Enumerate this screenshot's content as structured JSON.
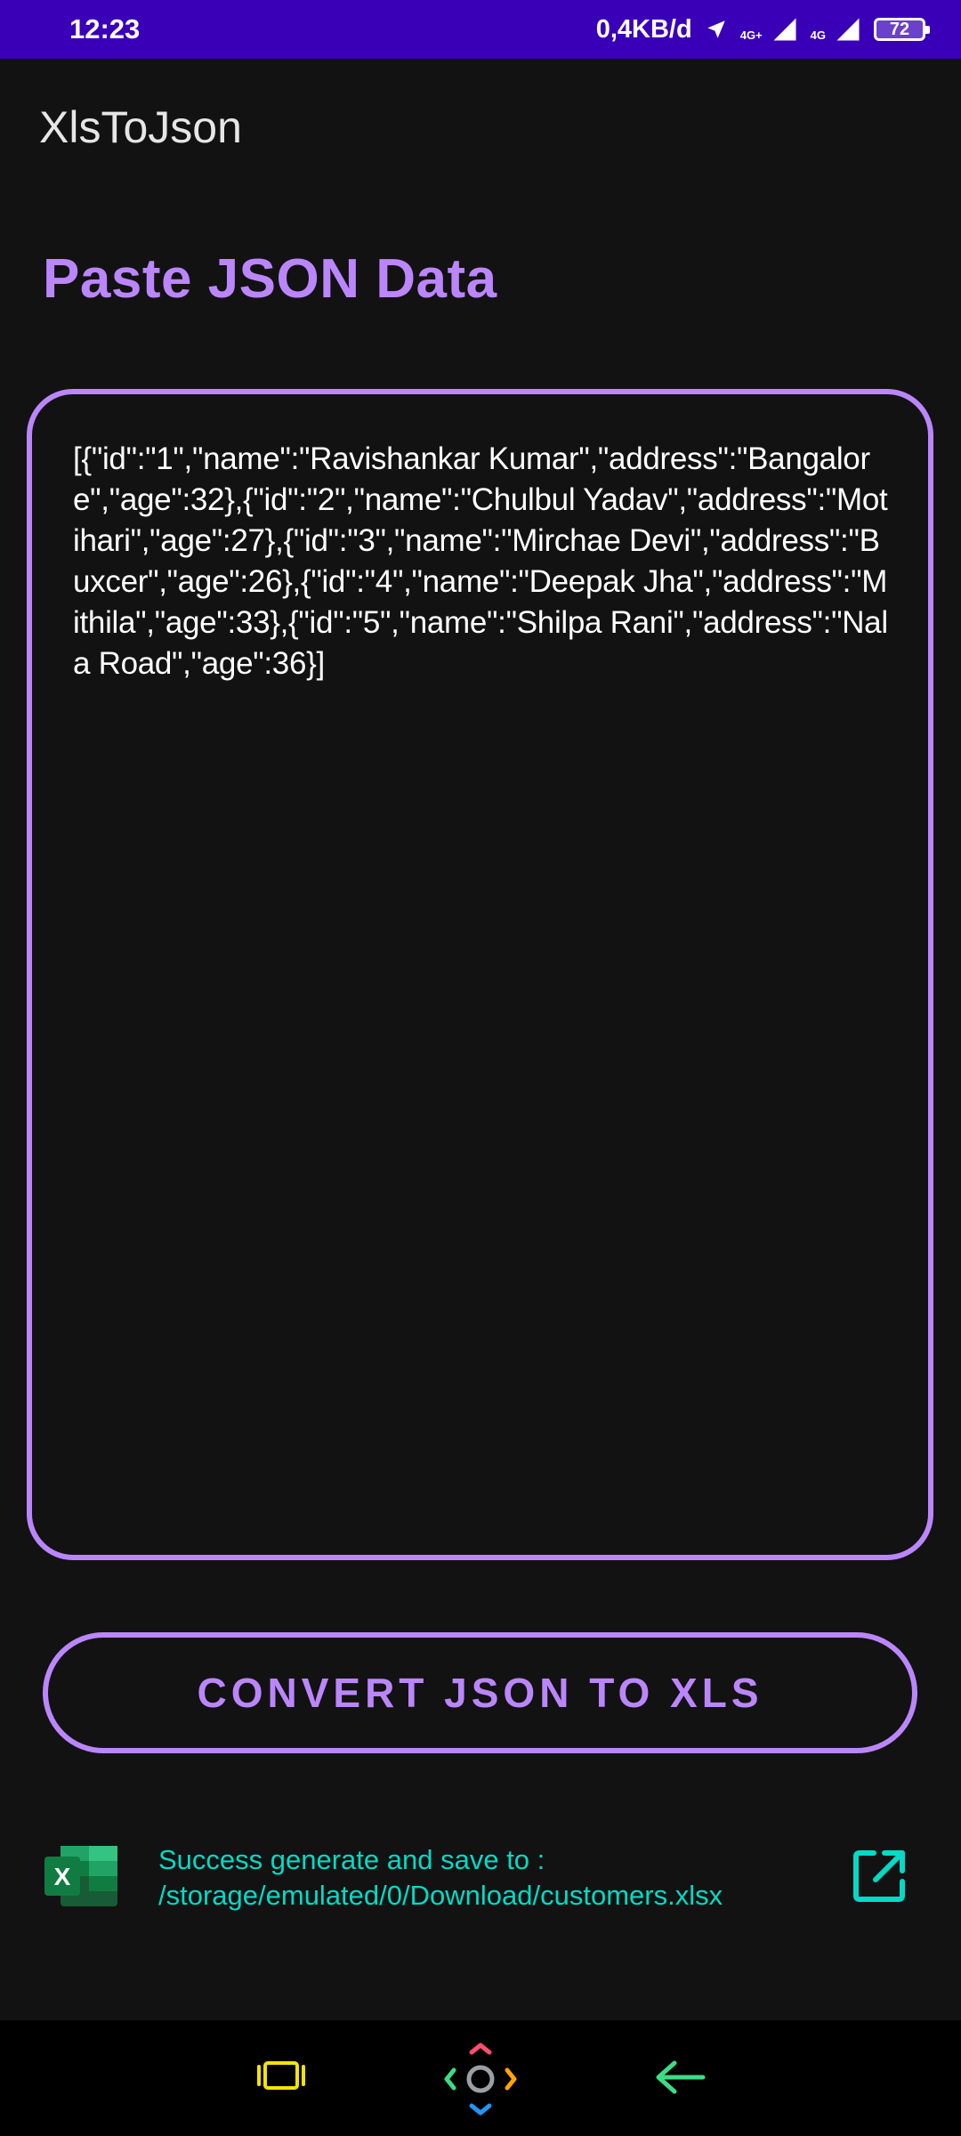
{
  "status_bar": {
    "time": "12:23",
    "data_rate": "0,4KB/d",
    "net_type_1": "4G+",
    "net_type_2": "4G",
    "battery": "72"
  },
  "app_bar": {
    "title": "XlsToJson"
  },
  "main": {
    "section_title": "Paste JSON Data",
    "json_input_value": "[{\"id\":\"1\",\"name\":\"Ravishankar Kumar\",\"address\":\"Bangalore\",\"age\":32},{\"id\":\"2\",\"name\":\"Chulbul Yadav\",\"address\":\"Motihari\",\"age\":27},{\"id\":\"3\",\"name\":\"Mirchae Devi\",\"address\":\"Buxcer\",\"age\":26},{\"id\":\"4\",\"name\":\"Deepak Jha\",\"address\":\"Mithila\",\"age\":33},{\"id\":\"5\",\"name\":\"Shilpa Rani\",\"address\":\"Nala Road\",\"age\":36}]",
    "convert_button_label": "CONVERT JSON TO XLS",
    "result_message": "Success generate and save to : /storage/emulated/0/Download/customers.xlsx",
    "excel_icon_letter": "X"
  },
  "colors": {
    "status_bar": "#3a00b8",
    "accent_purple": "#bb86fc",
    "accent_teal": "#03dac5",
    "background": "#121212"
  },
  "icons": {
    "excel": "excel-file-icon",
    "open_external": "open-in-new-icon",
    "nav_recents": "recents-icon",
    "nav_home": "home-icon",
    "nav_back": "back-icon"
  }
}
